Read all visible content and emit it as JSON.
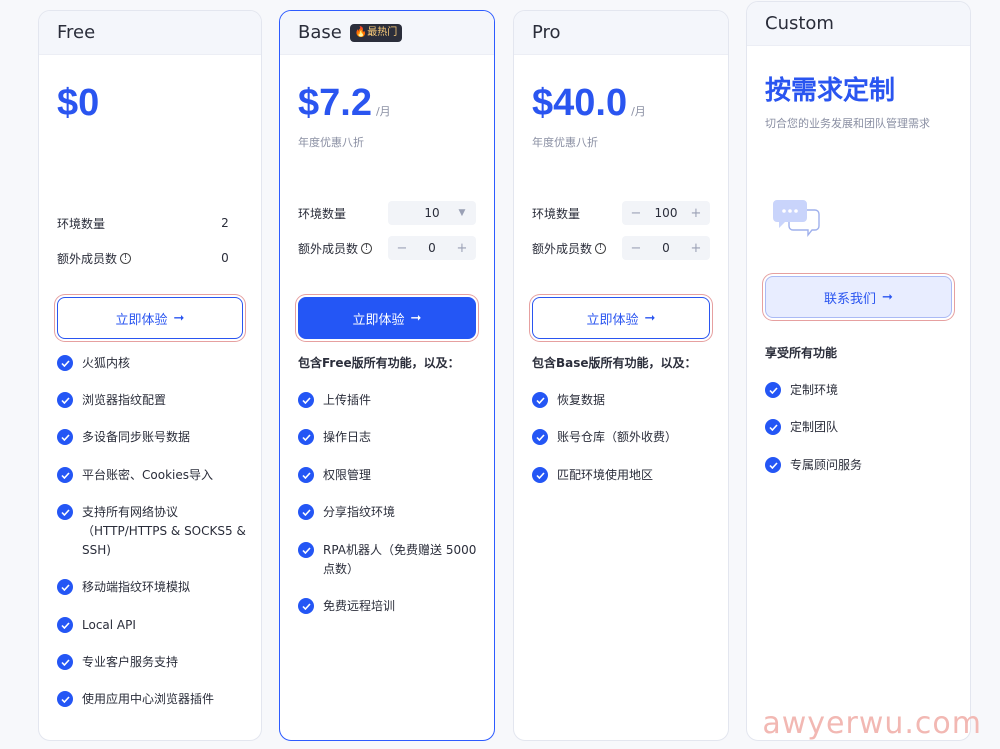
{
  "plans": {
    "free": {
      "name": "Free",
      "price": "$0",
      "options": {
        "env_label": "环境数量",
        "env_value": "2",
        "member_label": "额外成员数",
        "member_value": "0"
      },
      "cta": "立即体验",
      "features": [
        "火狐内核",
        "浏览器指纹配置",
        "多设备同步账号数据",
        "平台账密、Cookies导入",
        "支持所有网络协议（HTTP/HTTPS & SOCKS5 & SSH)",
        "移动端指纹环境模拟",
        "Local API",
        "专业客户服务支持",
        "使用应用中心浏览器插件"
      ]
    },
    "base": {
      "name": "Base",
      "badge": "🔥最热门",
      "price": "$7.2",
      "per": "/月",
      "discount": "年度优惠八折",
      "options": {
        "env_label": "环境数量",
        "env_value": "10",
        "member_label": "额外成员数",
        "member_value": "0"
      },
      "cta": "立即体验",
      "includes": "包含Free版所有功能，以及：",
      "features": [
        "上传插件",
        "操作日志",
        "权限管理",
        "分享指纹环境",
        "RPA机器人（免费赠送 5000 点数）",
        "免费远程培训"
      ]
    },
    "pro": {
      "name": "Pro",
      "price": "$40.0",
      "per": "/月",
      "discount": "年度优惠八折",
      "options": {
        "env_label": "环境数量",
        "env_value": "100",
        "member_label": "额外成员数",
        "member_value": "0"
      },
      "cta": "立即体验",
      "includes": "包含Base版所有功能，以及：",
      "features": [
        "恢复数据",
        "账号仓库（额外收费）",
        "匹配环境使用地区"
      ]
    },
    "custom": {
      "name": "Custom",
      "title": "按需求定制",
      "subtitle": "切合您的业务发展和团队管理需求",
      "cta": "联系我们",
      "includes": "享受所有功能",
      "features": [
        "定制环境",
        "定制团队",
        "专属顾问服务"
      ]
    }
  },
  "icons": {
    "check": "check-circle-icon",
    "info": "info-icon",
    "arrow": "arrow-right-icon",
    "chat": "chat-bubbles-icon"
  },
  "colors": {
    "accent": "#2456f5",
    "price": "#2a55f0",
    "base_border": "#2d5bff"
  },
  "watermark": "awyerwu.com"
}
